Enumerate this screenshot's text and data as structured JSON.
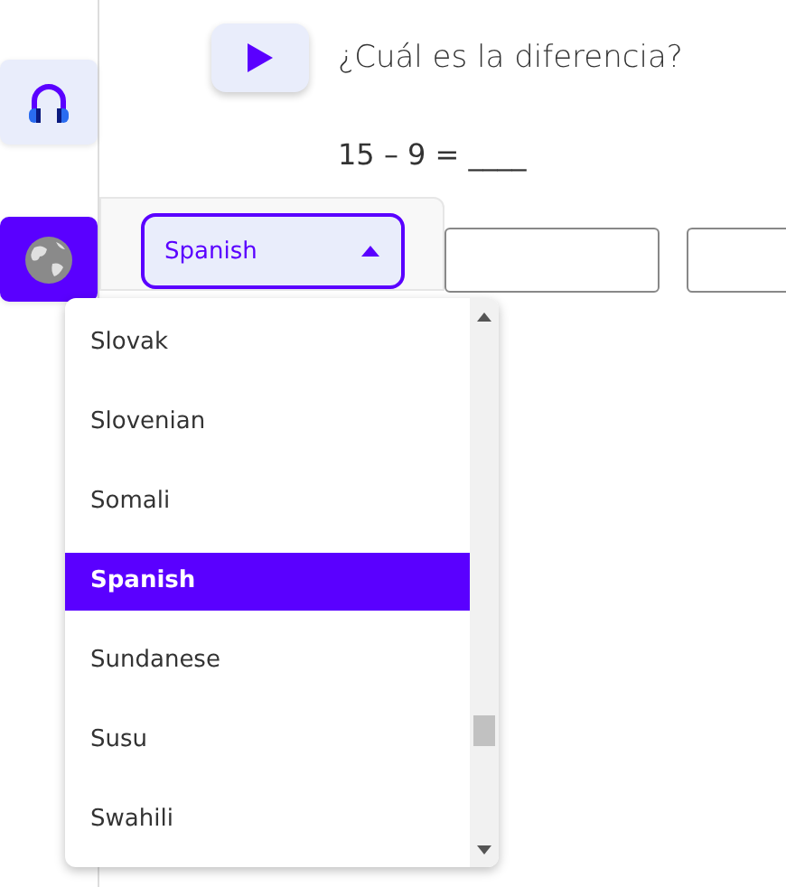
{
  "question": {
    "text": "¿Cuál es la diferencia?",
    "equation": "15 – 9 = ____"
  },
  "sidebar": {
    "items": [
      {
        "kind": "audio",
        "selected": false
      },
      {
        "kind": "language",
        "selected": true
      }
    ]
  },
  "language_select": {
    "value": "Spanish",
    "expanded": true
  },
  "answer_boxes": [
    {
      "kind": "text"
    },
    {
      "kind": "text"
    }
  ],
  "dropdown": {
    "options": [
      {
        "label": "Slovak",
        "selected": false
      },
      {
        "label": "Slovenian",
        "selected": false
      },
      {
        "label": "Somali",
        "selected": false
      },
      {
        "label": "Spanish",
        "selected": true
      },
      {
        "label": "Sundanese",
        "selected": false
      },
      {
        "label": "Susu",
        "selected": false
      },
      {
        "label": "Swahili",
        "selected": false
      }
    ]
  }
}
